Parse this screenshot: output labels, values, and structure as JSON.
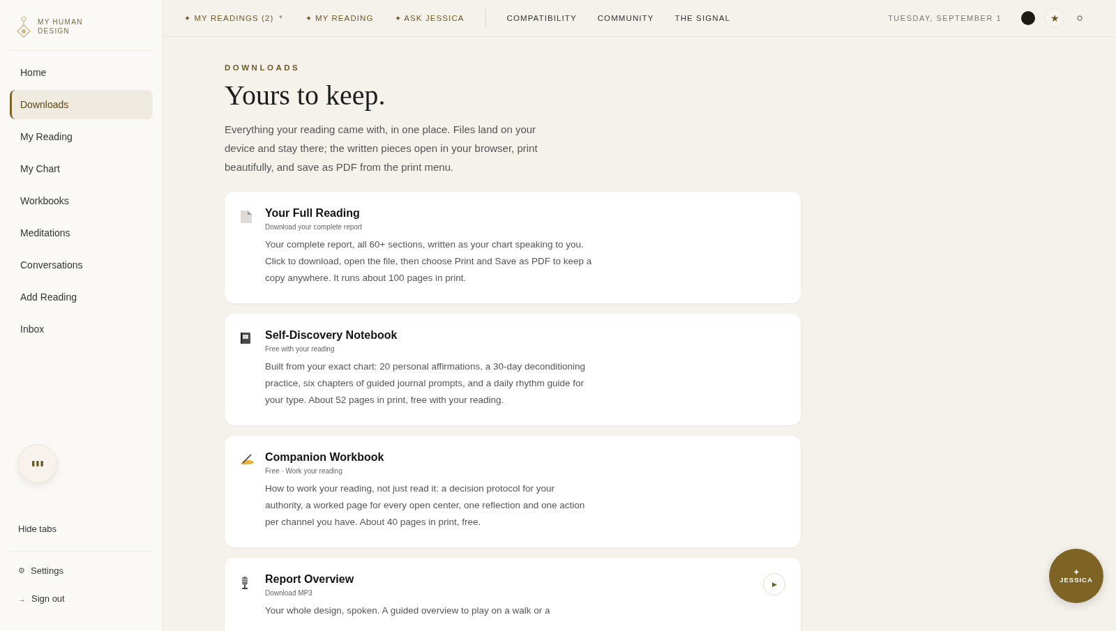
{
  "brand": {
    "lines": [
      "MY HUMAN",
      "DESIGN"
    ]
  },
  "topnav": {
    "primary": [
      {
        "icon": "✦",
        "label": "MY READINGS (2)",
        "caret": "▼"
      },
      {
        "icon": "✦",
        "label": "MY READING"
      },
      {
        "icon": "✦",
        "label": "ASK JESSICA"
      }
    ],
    "secondary": [
      {
        "label": "COMPATIBILITY"
      },
      {
        "label": "COMMUNITY"
      },
      {
        "label": "THE SIGNAL"
      }
    ],
    "date": "TUESDAY, SEPTEMBER 1",
    "star": "★"
  },
  "sidebar": {
    "items": [
      {
        "label": "Home",
        "selected": false
      },
      {
        "label": "Downloads",
        "selected": true
      },
      {
        "label": "My Reading",
        "selected": false
      },
      {
        "label": "My Chart",
        "selected": false
      },
      {
        "label": "Workbooks",
        "selected": false
      },
      {
        "label": "Meditations",
        "selected": false
      },
      {
        "label": "Conversations",
        "selected": false
      },
      {
        "label": "Add Reading",
        "selected": false
      },
      {
        "label": "Inbox",
        "selected": false
      }
    ],
    "hide_tabs": "Hide tabs",
    "footer": [
      {
        "icon": "⚙",
        "label": "Settings"
      },
      {
        "icon": "→",
        "label": "Sign out"
      }
    ]
  },
  "page": {
    "eyebrow": "DOWNLOADS",
    "title": "Yours to keep.",
    "intro": "Everything your reading came with, in one place. Files land on your device and stay there; the written pieces open in your browser, print beautifully, and save as PDF from the print menu."
  },
  "cards": [
    {
      "kind": "document",
      "title": "Your Full Reading",
      "subtitle": "Download your complete report",
      "body": "Your complete report, all 60+ sections, written as your chart speaking to you. Click to download, open the file, then choose Print and Save as PDF to keep a copy anywhere. It runs about 100 pages in print."
    },
    {
      "kind": "notebook",
      "title": "Self-Discovery Notebook",
      "subtitle": "Free with your reading",
      "body": "Built from your exact chart: 20 personal affirmations, a 30-day deconditioning practice, six chapters of guided journal prompts, and a daily rhythm guide for your type. About 52 pages in print, free with your reading."
    },
    {
      "kind": "writing",
      "title": "Companion Workbook",
      "subtitle": "Free · Work your reading",
      "body": "How to work your reading, not just read it: a decision protocol for your authority, a worked page for every open center, one reflection and one action per channel you have. About 40 pages in print, free."
    },
    {
      "kind": "microphone",
      "title": "Report Overview",
      "subtitle": "Download MP3",
      "body": "Your whole design, spoken. A guided overview to play on a walk or a",
      "play": "▶"
    }
  ],
  "fab": {
    "icon": "✦",
    "label": "JESSICA"
  }
}
